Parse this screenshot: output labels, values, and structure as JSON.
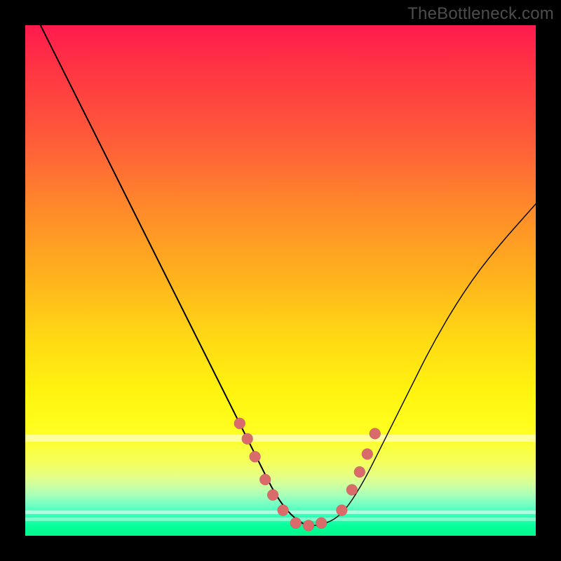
{
  "watermark": "TheBottleneck.com",
  "chart_data": {
    "type": "line",
    "title": "",
    "xlabel": "",
    "ylabel": "",
    "xlim": [
      0,
      100
    ],
    "ylim": [
      0,
      100
    ],
    "series": [
      {
        "name": "bottleneck-curve",
        "x": [
          3,
          8,
          14,
          20,
          26,
          32,
          38,
          42,
          46,
          49,
          52,
          55,
          58,
          62,
          66,
          70,
          75,
          80,
          86,
          92,
          100
        ],
        "y": [
          100,
          90,
          78,
          66,
          54,
          42,
          30,
          22,
          14,
          8,
          4,
          2,
          2,
          4,
          10,
          18,
          28,
          38,
          48,
          56,
          65
        ]
      }
    ],
    "markers": {
      "name": "highlight-dots",
      "x": [
        42,
        43.5,
        45,
        47,
        48.5,
        50.5,
        53,
        55.5,
        58,
        62,
        64,
        65.5,
        67,
        68.5
      ],
      "y": [
        22,
        19,
        15.5,
        11,
        8,
        5,
        2.5,
        2,
        2.5,
        5,
        9,
        12.5,
        16,
        20
      ]
    },
    "bands": [
      {
        "top_pct": 80.2,
        "height_pct": 1.4,
        "color": "rgba(255,255,180,0.85)"
      },
      {
        "top_pct": 95.0,
        "height_pct": 0.8,
        "color": "rgba(255,255,255,0.55)"
      },
      {
        "top_pct": 96.4,
        "height_pct": 0.7,
        "color": "rgba(200,255,230,0.55)"
      }
    ]
  }
}
